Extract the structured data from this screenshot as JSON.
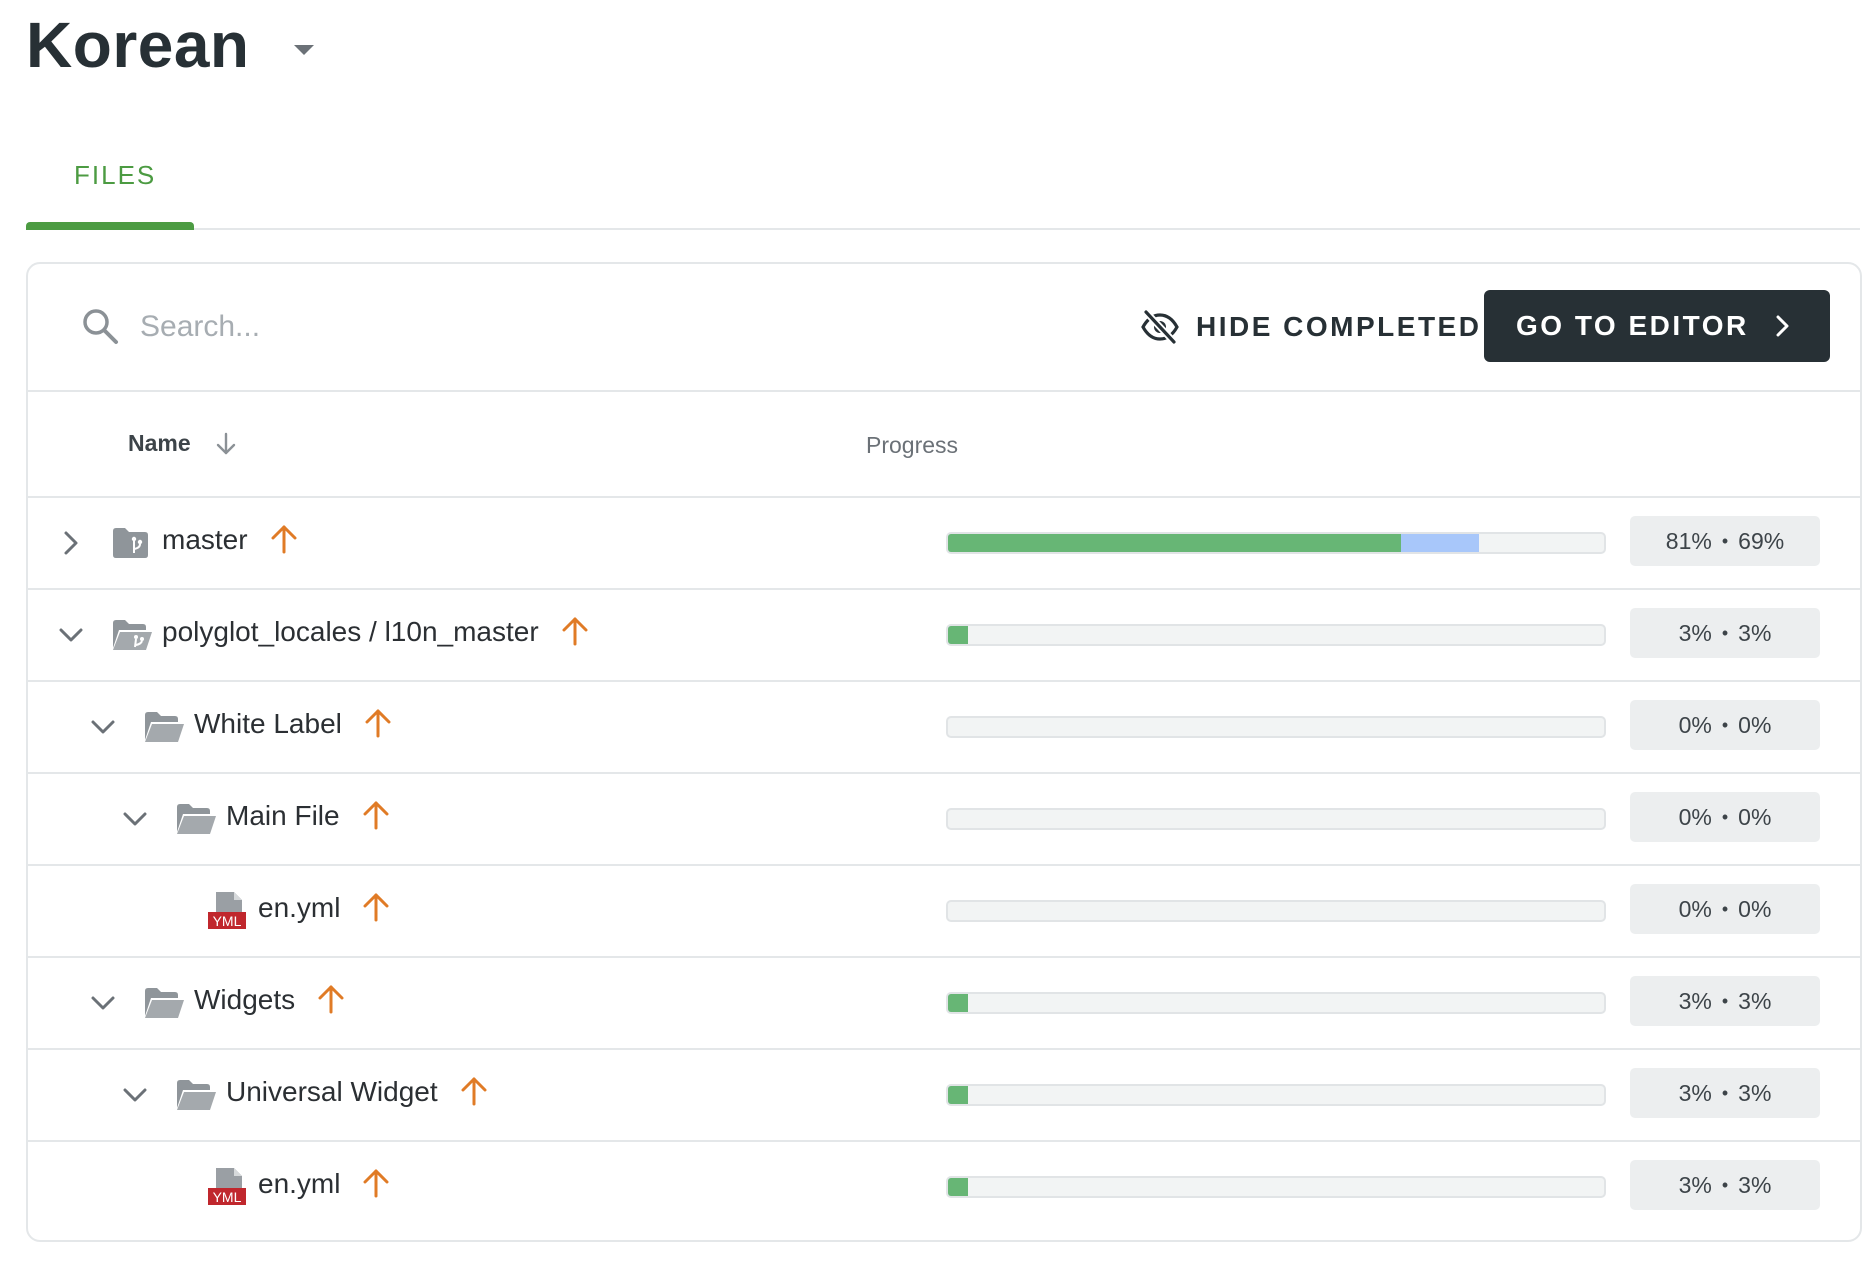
{
  "header": {
    "language": "Korean"
  },
  "tabs": [
    {
      "label": "FILES",
      "active": true
    }
  ],
  "toolbar": {
    "search_placeholder": "Search...",
    "hide_completed_label": "HIDE COMPLETED",
    "go_to_editor_label": "GO TO EDITOR"
  },
  "table": {
    "columns": {
      "name": "Name",
      "progress": "Progress"
    },
    "rows": [
      {
        "name": "master",
        "type": "branch",
        "depth": 0,
        "expanded": false,
        "review": 0.69,
        "translated": 0.81,
        "reviewed_label": "81%",
        "approved_label": "69%"
      },
      {
        "name": "polyglot_locales / l10n_master",
        "type": "branch-open",
        "depth": 0,
        "expanded": true,
        "review": 0.03,
        "translated": 0.03,
        "reviewed_label": "3%",
        "approved_label": "3%"
      },
      {
        "name": "White Label",
        "type": "folder",
        "depth": 1,
        "expanded": true,
        "review": 0,
        "translated": 0,
        "reviewed_label": "0%",
        "approved_label": "0%"
      },
      {
        "name": "Main File",
        "type": "folder",
        "depth": 2,
        "expanded": true,
        "review": 0,
        "translated": 0,
        "reviewed_label": "0%",
        "approved_label": "0%"
      },
      {
        "name": "en.yml",
        "type": "file",
        "depth": 3,
        "file_badge": "YML",
        "review": 0,
        "translated": 0,
        "reviewed_label": "0%",
        "approved_label": "0%"
      },
      {
        "name": "Widgets",
        "type": "folder",
        "depth": 1,
        "expanded": true,
        "review": 0.03,
        "translated": 0.03,
        "reviewed_label": "3%",
        "approved_label": "3%"
      },
      {
        "name": "Universal Widget",
        "type": "folder",
        "depth": 2,
        "expanded": true,
        "review": 0.03,
        "translated": 0.03,
        "reviewed_label": "3%",
        "approved_label": "3%"
      },
      {
        "name": "en.yml",
        "type": "file",
        "depth": 3,
        "file_badge": "YML",
        "review": 0.03,
        "translated": 0.03,
        "reviewed_label": "3%",
        "approved_label": "3%"
      }
    ]
  },
  "colors": {
    "accent_green": "#4c9b42",
    "dark": "#273035",
    "upload_orange": "#e07b26",
    "bar_review": "#4caf3c",
    "bar_translated": "#a8c7fa"
  },
  "icons": {
    "search": "search-icon",
    "hide": "eye-off-icon",
    "editor": "chevron-right-icon",
    "sort": "arrow-down-icon",
    "upload": "arrow-up-icon"
  }
}
